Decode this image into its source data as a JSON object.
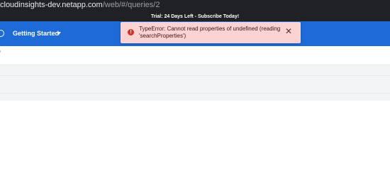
{
  "browser": {
    "url_host": "cloudinsights-dev.netapp.com",
    "url_path": "/web/#/queries/2"
  },
  "trial": {
    "text": "Trial: 24 Days Left - Subscribe Today!"
  },
  "nav": {
    "getting_started_label": "Getting Started"
  },
  "breadcrumb": {
    "separator": "/"
  },
  "toast": {
    "message": "TypeError: Cannot read properties of undefined (reading 'searchProperties')",
    "error_glyph": "!",
    "close_glyph": "✕",
    "accent_color": "#d93025",
    "background_color": "#fbd3d3"
  },
  "colors": {
    "nav_blue": "#1e6ad6",
    "browser_dark": "#202124"
  }
}
